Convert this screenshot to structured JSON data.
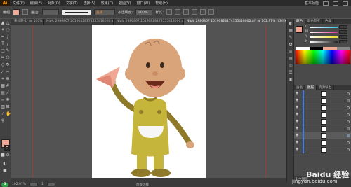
{
  "app": {
    "logo": "Ai",
    "menus": [
      "文件(F)",
      "编辑(E)",
      "对象(O)",
      "文字(T)",
      "选择(S)",
      "效果(C)",
      "视图(V)",
      "窗口(W)",
      "帮助(H)"
    ],
    "workspace": "基本功能"
  },
  "control_bar": {
    "selection_label": "编组",
    "fill_color": "#f0a895",
    "stroke_label": "描边:",
    "stroke_weight": "",
    "brush_label": "基本",
    "opacity_label": "不透明度:",
    "opacity_value": "100%",
    "style_label": "样式:"
  },
  "document_tabs": [
    {
      "label": "未标题-1* @ 100%",
      "active": false
    },
    {
      "label": "Nipic 2986867 20190828174355418000.ai*",
      "active": false
    },
    {
      "label": "Nipic 2986867 20190828174355418000.ai*",
      "active": false
    },
    {
      "label": "Nipic 2986867 20190828174355418000.ai* @ 102.97% (CMYK/预览)",
      "active": true
    }
  ],
  "canvas": {
    "artboard_color": "#ffffff",
    "baby": {
      "skin": "#d9a47a",
      "outfit": "#c5b53b",
      "outfit_dark": "#8f7a2a",
      "plane": "#f0a895",
      "mouth": "#6b2a1a",
      "cuff": "#f6f6f6"
    }
  },
  "status_bar": {
    "zoom": "102.97%",
    "page": "1",
    "tool_name": "直接选择",
    "logo": "5"
  },
  "right_panel": {
    "tabs": [
      "颜色",
      "颜色参考",
      "色板"
    ],
    "fill_color": "#f0a895",
    "sliders": [
      {
        "label": "C",
        "color": "#31c4e4"
      },
      {
        "label": "M",
        "color": "#e4319b"
      },
      {
        "label": "Y",
        "color": "#f0e020"
      },
      {
        "label": "K",
        "color": "#202020"
      }
    ],
    "layers_tabs": [
      "图层",
      "画板",
      "资源导出"
    ],
    "layers_footer": "1 个图层"
  },
  "watermark": {
    "text": "Baidu 经验",
    "url": "jingyan.baidu.com"
  }
}
